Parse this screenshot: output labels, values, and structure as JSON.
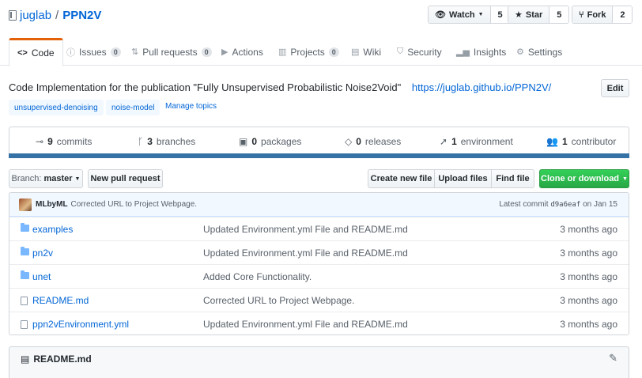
{
  "repo": {
    "owner": "juglab",
    "separator": "/",
    "name": "PPN2V"
  },
  "header_buttons": {
    "watch": {
      "label": "Watch",
      "count": "5"
    },
    "star": {
      "label": "Star",
      "count": "5"
    },
    "fork": {
      "label": "Fork",
      "count": "2"
    }
  },
  "tabs": [
    {
      "label": "Code"
    },
    {
      "label": "Issues",
      "badge": "0"
    },
    {
      "label": "Pull requests",
      "badge": "0"
    },
    {
      "label": "Actions"
    },
    {
      "label": "Projects",
      "badge": "0"
    },
    {
      "label": "Wiki"
    },
    {
      "label": "Security"
    },
    {
      "label": "Insights"
    },
    {
      "label": "Settings"
    }
  ],
  "description": {
    "text": "Code Implementation for the publication \"Fully Unsupervised Probabilistic Noise2Void\"",
    "url": "https://juglab.github.io/PPN2V/",
    "edit_label": "Edit"
  },
  "topics": [
    "unsupervised-denoising",
    "noise-model"
  ],
  "manage_topics": "Manage topics",
  "summary": {
    "commits": {
      "count": "9",
      "label": "commits"
    },
    "branches": {
      "count": "3",
      "label": "branches"
    },
    "packages": {
      "count": "0",
      "label": "packages"
    },
    "releases": {
      "count": "0",
      "label": "releases"
    },
    "environment": {
      "count": "1",
      "label": "environment"
    },
    "contributors": {
      "count": "1",
      "label": "contributor"
    },
    "language_bar_color": "#3572A5"
  },
  "toolbar": {
    "branch_prefix": "Branch:",
    "branch_name": "master",
    "new_pr": "New pull request",
    "create_file": "Create new file",
    "upload_files": "Upload files",
    "find_file": "Find file",
    "clone": "Clone or download"
  },
  "latest_commit": {
    "author": "MLbyML",
    "message": "Corrected URL to Project Webpage.",
    "prefix": "Latest commit",
    "sha": "d9a6eaf",
    "date": "on Jan 15"
  },
  "files": [
    {
      "name": "examples",
      "type": "dir",
      "message": "Updated Environment.yml File and README.md",
      "age": "3 months ago"
    },
    {
      "name": "pn2v",
      "type": "dir",
      "message": "Updated Environment.yml File and README.md",
      "age": "3 months ago"
    },
    {
      "name": "unet",
      "type": "dir",
      "message": "Added Core Functionality.",
      "age": "3 months ago"
    },
    {
      "name": "README.md",
      "type": "file",
      "message": "Corrected URL to Project Webpage.",
      "age": "3 months ago"
    },
    {
      "name": "ppn2vEnvironment.yml",
      "type": "file",
      "message": "Updated Environment.yml File and README.md",
      "age": "3 months ago"
    }
  ],
  "readme": {
    "title": "README.md"
  },
  "colors": {
    "link": "#0366d6",
    "accent_tab": "#e36209",
    "clone_button": "#28a745"
  }
}
